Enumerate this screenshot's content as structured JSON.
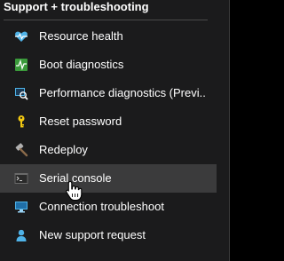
{
  "section": {
    "title": "Support + troubleshooting"
  },
  "items": [
    {
      "label": "Resource health",
      "icon": "heart-pulse-icon"
    },
    {
      "label": "Boot diagnostics",
      "icon": "boot-diagnostics-icon"
    },
    {
      "label": "Performance diagnostics (Previ...",
      "icon": "performance-diagnostics-icon"
    },
    {
      "label": "Reset password",
      "icon": "key-icon"
    },
    {
      "label": "Redeploy",
      "icon": "hammer-icon"
    },
    {
      "label": "Serial console",
      "icon": "console-icon",
      "selected": true
    },
    {
      "label": "Connection troubleshoot",
      "icon": "connection-icon"
    },
    {
      "label": "New support request",
      "icon": "support-person-icon"
    }
  ],
  "colors": {
    "background": "#1b1b1c",
    "selected": "#3b3b3c",
    "text": "#ffffff",
    "heart": "#4fb3e8",
    "boot": "#3a9a3a",
    "key": "#f2c811",
    "hammer": "#9a9a9a",
    "console": "#6a6a6a"
  }
}
